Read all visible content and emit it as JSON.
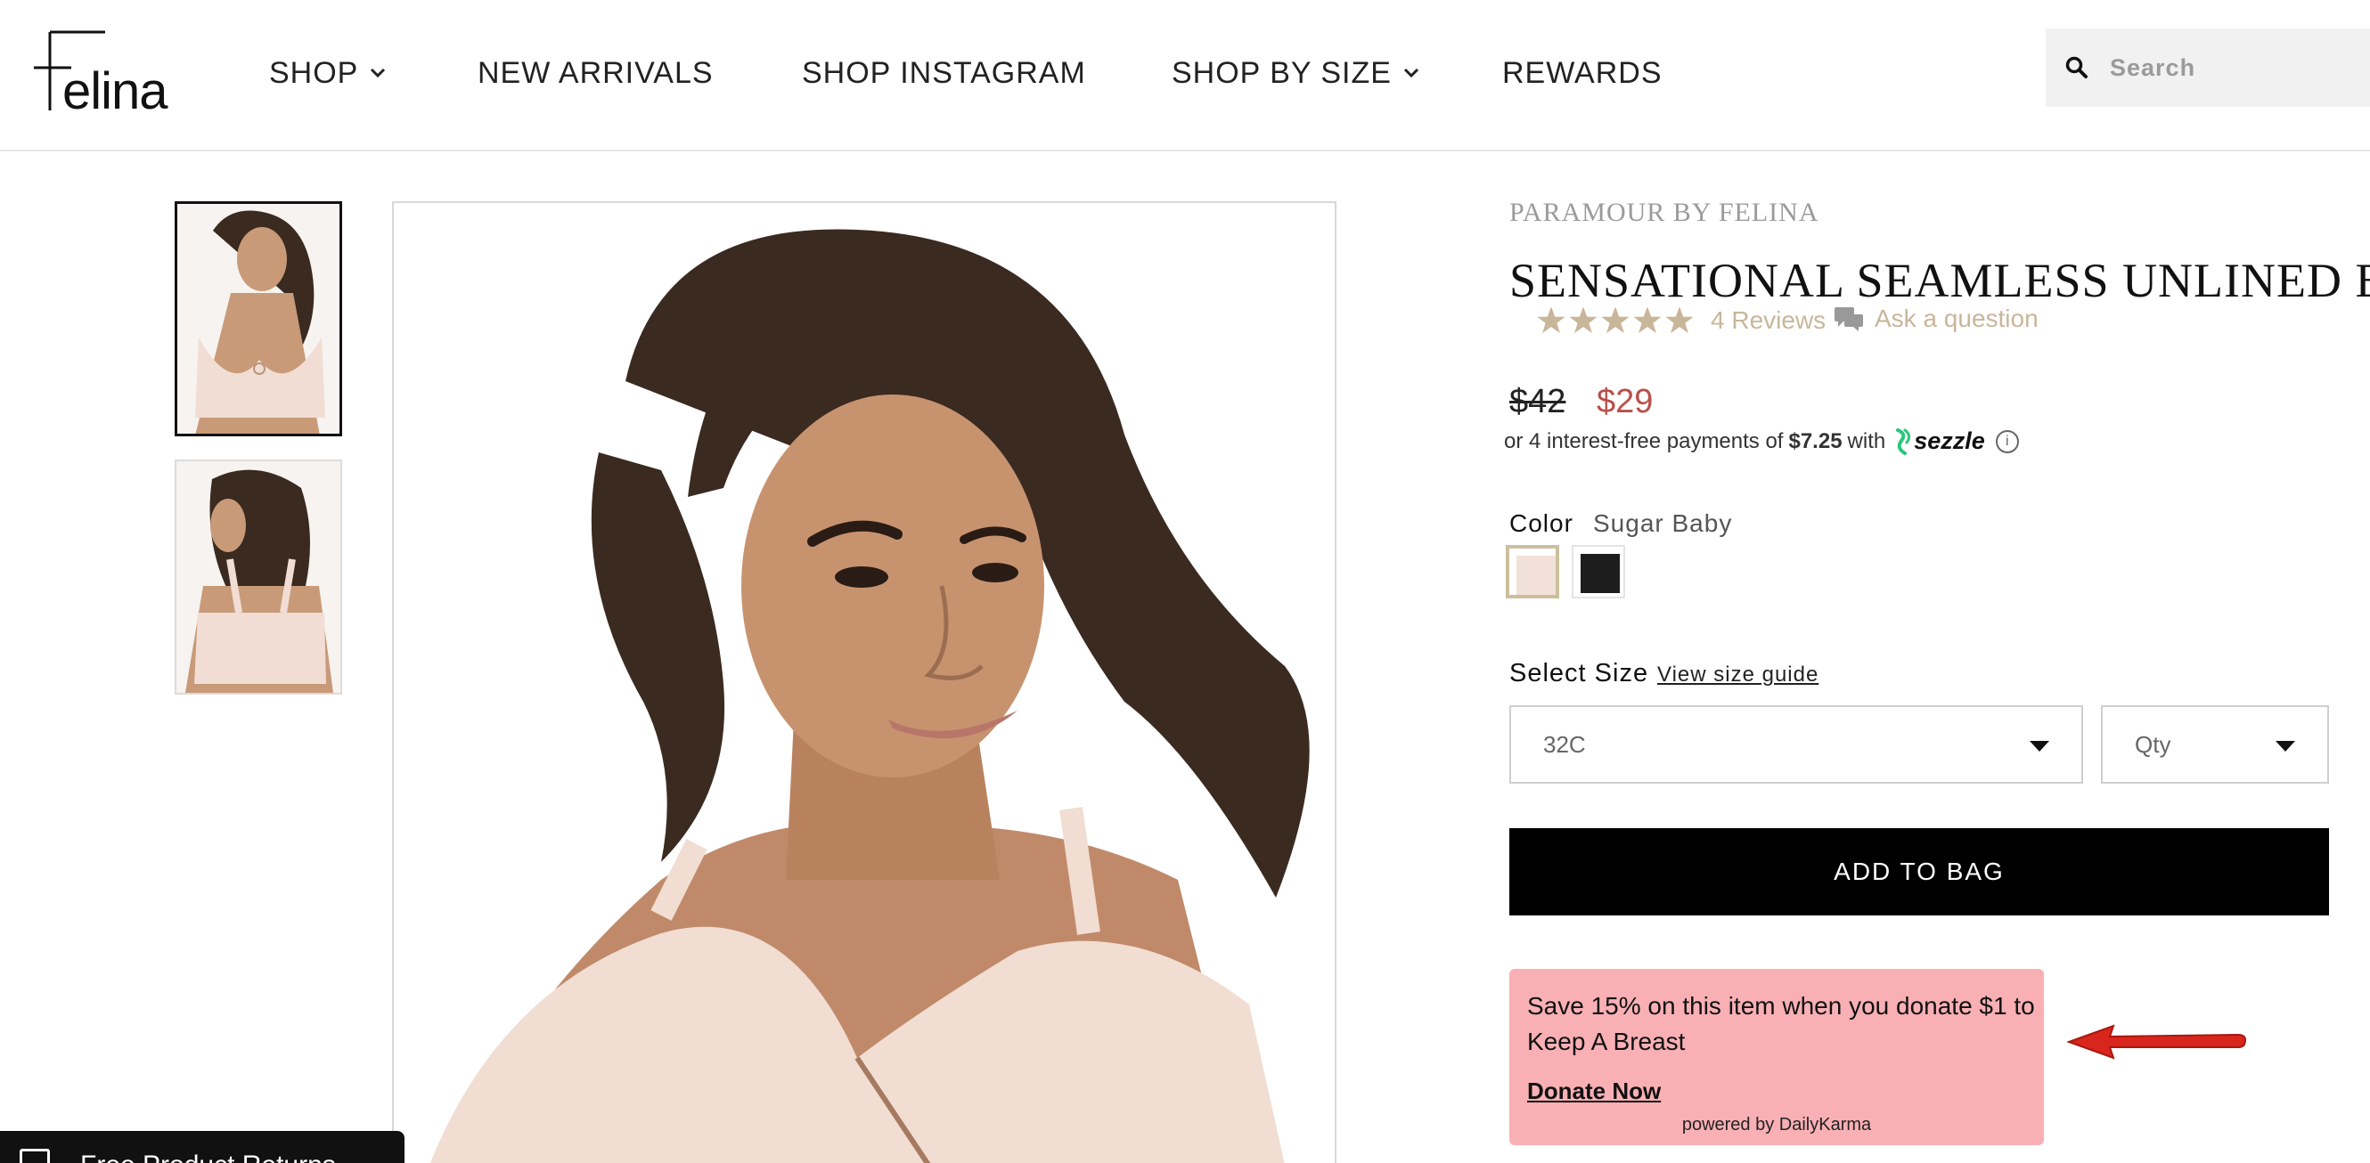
{
  "header": {
    "logo_text": "Felina",
    "nav": [
      {
        "label": "SHOP",
        "dropdown": true
      },
      {
        "label": "NEW ARRIVALS",
        "dropdown": false
      },
      {
        "label": "SHOP INSTAGRAM",
        "dropdown": false
      },
      {
        "label": "SHOP BY SIZE",
        "dropdown": true
      },
      {
        "label": "REWARDS",
        "dropdown": false
      }
    ],
    "search": {
      "placeholder": "Search",
      "icon": "search-icon"
    }
  },
  "gallery": {
    "thumbnails": [
      {
        "name": "front-view",
        "active": true
      },
      {
        "name": "back-view",
        "active": false
      }
    ],
    "review_bar_text": "Free Product Returns"
  },
  "product": {
    "brand": "PARAMOUR BY FELINA",
    "title": "SENSATIONAL SEAMLESS UNLINED BRA",
    "rating": {
      "stars": 5,
      "max": 5,
      "reviews_label": "4 Reviews"
    },
    "ask_question_label": "Ask a question",
    "price": {
      "original": "$42",
      "sale": "$29"
    },
    "sezzle": {
      "prefix": "or 4 interest-free payments of",
      "amount": "$7.25",
      "with": "with",
      "brand": "sezzle",
      "info_symbol": "i"
    },
    "color": {
      "label": "Color",
      "selected": "Sugar Baby",
      "swatches": [
        {
          "name": "Sugar Baby",
          "hex": "#f2e1d8",
          "selected": true
        },
        {
          "name": "Black",
          "hex": "#1d1d1d",
          "selected": false
        }
      ]
    },
    "size": {
      "label": "Select Size",
      "guide_label": "View size guide",
      "size_value": "32C",
      "qty_value": "Qty"
    },
    "add_to_bag": "ADD TO BAG",
    "promo": {
      "message": "Save 15% on this item when you donate $1 to Keep A Breast",
      "cta": "Donate Now",
      "powered_by": "powered by DailyKarma",
      "bg": "#f9b0b5"
    }
  },
  "colors": {
    "accent_gold": "#c9b69a",
    "sale_red": "#b8504a",
    "annotation_arrow": "#d9261c"
  }
}
